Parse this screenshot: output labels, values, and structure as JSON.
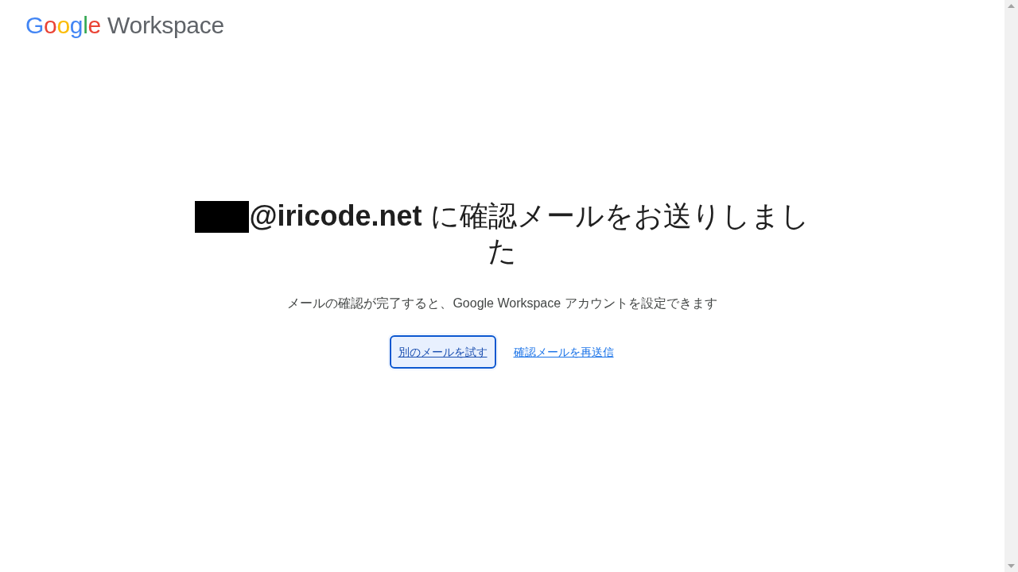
{
  "logo": {
    "brand": "Google",
    "product": "Workspace"
  },
  "heading": {
    "redacted": true,
    "text": "**@iricode.net** に確認メールをお送りしました"
  },
  "subtitle": "メールの確認が完了すると、Google Workspace アカウントを設定できます",
  "actions": [
    {
      "kind": "button",
      "label": "別のメールを試す",
      "focused": true
    },
    {
      "kind": "link",
      "label": "確認メールを再送信",
      "focused": false
    }
  ]
}
